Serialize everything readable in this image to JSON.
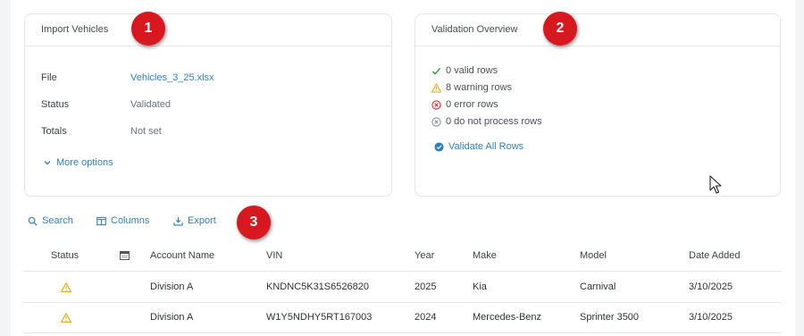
{
  "import_card": {
    "title": "Import Vehicles",
    "file_label": "File",
    "file_value": "Vehicles_3_25.xlsx",
    "status_label": "Status",
    "status_value": "Validated",
    "totals_label": "Totals",
    "totals_value": "Not set",
    "more_options": "More options"
  },
  "validation_card": {
    "title": "Validation Overview",
    "rows": [
      {
        "text": "0 valid rows",
        "icon": "check-icon",
        "color": "#3a9a3a"
      },
      {
        "text": "8 warning rows",
        "icon": "warning-icon",
        "color": "#e8b21e"
      },
      {
        "text": "0 error rows",
        "icon": "error-icon",
        "color": "#d12d2d"
      },
      {
        "text": "0 do not process rows",
        "icon": "skip-icon",
        "color": "#8a8f96"
      }
    ],
    "validate_all": "Validate All Rows"
  },
  "badges": [
    "1",
    "2",
    "3"
  ],
  "toolbar": {
    "search": "Search",
    "columns": "Columns",
    "export": "Export"
  },
  "table": {
    "headers": [
      "Status",
      "",
      "Account Name",
      "VIN",
      "Year",
      "Make",
      "Model",
      "Date Added"
    ],
    "rows": [
      {
        "status": "warning",
        "account": "Division A",
        "vin": "KNDNC5K31S6526820",
        "year": "2025",
        "make": "Kia",
        "model": "Carnival",
        "date": "3/10/2025"
      },
      {
        "status": "warning",
        "account": "Division A",
        "vin": "W1Y5NDHY5RT167003",
        "year": "2024",
        "make": "Mercedes-Benz",
        "model": "Sprinter 3500",
        "date": "3/10/2025"
      }
    ]
  },
  "colors": {
    "accent": "#2f7fc1",
    "badge": "#d7191f",
    "warning": "#e8b21e"
  }
}
